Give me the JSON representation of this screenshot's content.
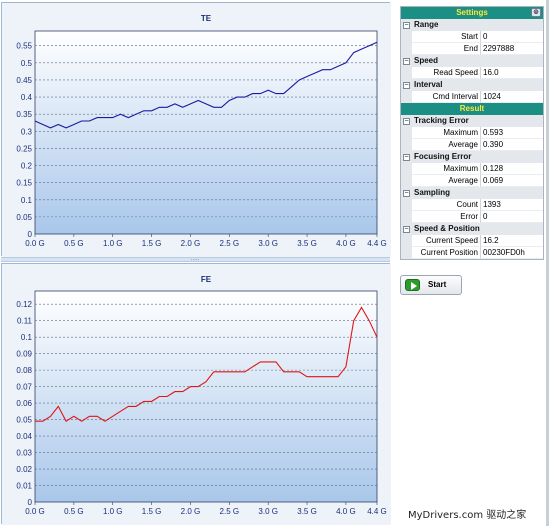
{
  "colors": {
    "te_line": "#1a1aa0",
    "fe_line": "#e01515",
    "plot_bg_top": "#ffffff",
    "plot_bg_bottom": "#a9c7ea",
    "header_bg": "#1b8f83",
    "header_text": "#ffe63a"
  },
  "chart_data": [
    {
      "type": "line",
      "title": "TE",
      "xlabel": "",
      "ylabel": "",
      "xlim": [
        0,
        4.4
      ],
      "ylim": [
        0,
        0.593
      ],
      "x_ticks": [
        "0.0 G",
        "0.5 G",
        "1.0 G",
        "1.5 G",
        "2.0 G",
        "2.5 G",
        "3.0 G",
        "3.5 G",
        "4.0 G",
        "4.4 G"
      ],
      "y_ticks": [
        "0",
        "0.05",
        "0.1",
        "0.15",
        "0.2",
        "0.25",
        "0.3",
        "0.35",
        "0.4",
        "0.45",
        "0.5",
        "0.55"
      ],
      "grid": true,
      "series": [
        {
          "color": "#1a1aa0",
          "x": [
            0,
            0.1,
            0.2,
            0.3,
            0.4,
            0.5,
            0.6,
            0.7,
            0.8,
            0.9,
            1.0,
            1.1,
            1.2,
            1.3,
            1.4,
            1.5,
            1.6,
            1.7,
            1.8,
            1.9,
            2.0,
            2.1,
            2.2,
            2.3,
            2.4,
            2.5,
            2.6,
            2.7,
            2.8,
            2.9,
            3.0,
            3.1,
            3.2,
            3.3,
            3.4,
            3.5,
            3.6,
            3.7,
            3.8,
            3.9,
            4.0,
            4.1,
            4.2,
            4.3,
            4.4
          ],
          "y": [
            0.33,
            0.32,
            0.31,
            0.32,
            0.31,
            0.32,
            0.33,
            0.33,
            0.34,
            0.34,
            0.34,
            0.35,
            0.34,
            0.35,
            0.36,
            0.36,
            0.37,
            0.37,
            0.38,
            0.37,
            0.38,
            0.39,
            0.38,
            0.37,
            0.37,
            0.39,
            0.4,
            0.4,
            0.41,
            0.41,
            0.42,
            0.41,
            0.41,
            0.43,
            0.45,
            0.46,
            0.47,
            0.48,
            0.48,
            0.49,
            0.5,
            0.53,
            0.54,
            0.55,
            0.56
          ]
        }
      ]
    },
    {
      "type": "line",
      "title": "FE",
      "xlabel": "",
      "ylabel": "",
      "xlim": [
        0,
        4.4
      ],
      "ylim": [
        0,
        0.128
      ],
      "x_ticks": [
        "0.0 G",
        "0.5 G",
        "1.0 G",
        "1.5 G",
        "2.0 G",
        "2.5 G",
        "3.0 G",
        "3.5 G",
        "4.0 G",
        "4.4 G"
      ],
      "y_ticks": [
        "0",
        "0.01",
        "0.02",
        "0.03",
        "0.04",
        "0.05",
        "0.06",
        "0.07",
        "0.08",
        "0.09",
        "0.1",
        "0.11",
        "0.12"
      ],
      "grid": true,
      "series": [
        {
          "color": "#e01515",
          "x": [
            0,
            0.1,
            0.2,
            0.3,
            0.4,
            0.5,
            0.6,
            0.7,
            0.8,
            0.9,
            1.0,
            1.1,
            1.2,
            1.3,
            1.4,
            1.5,
            1.6,
            1.7,
            1.8,
            1.9,
            2.0,
            2.1,
            2.2,
            2.3,
            2.4,
            2.5,
            2.6,
            2.7,
            2.8,
            2.9,
            3.0,
            3.1,
            3.2,
            3.3,
            3.4,
            3.5,
            3.6,
            3.7,
            3.8,
            3.9,
            4.0,
            4.1,
            4.2,
            4.3,
            4.4
          ],
          "y": [
            0.049,
            0.049,
            0.052,
            0.058,
            0.049,
            0.052,
            0.049,
            0.052,
            0.052,
            0.049,
            0.052,
            0.055,
            0.058,
            0.058,
            0.061,
            0.061,
            0.064,
            0.064,
            0.067,
            0.067,
            0.07,
            0.07,
            0.073,
            0.079,
            0.079,
            0.079,
            0.079,
            0.079,
            0.082,
            0.085,
            0.085,
            0.085,
            0.079,
            0.079,
            0.079,
            0.076,
            0.076,
            0.076,
            0.076,
            0.076,
            0.082,
            0.11,
            0.118,
            0.11,
            0.1
          ]
        }
      ]
    }
  ],
  "splitter": {
    "grip": "....."
  },
  "properties": {
    "settings_header": "Settings",
    "result_header": "Result",
    "categories": {
      "range": "Range",
      "speed": "Speed",
      "interval": "Interval",
      "tracking_error": "Tracking Error",
      "focusing_error": "Focusing Error",
      "sampling": "Sampling",
      "speed_position": "Speed & Position"
    },
    "rows": {
      "start": {
        "name": "Start",
        "value": "0"
      },
      "end": {
        "name": "End",
        "value": "2297888"
      },
      "read_speed": {
        "name": "Read Speed",
        "value": "16.0"
      },
      "cmd_interval": {
        "name": "Cmd Interval",
        "value": "1024"
      },
      "te_max": {
        "name": "Maximum",
        "value": "0.593"
      },
      "te_avg": {
        "name": "Average",
        "value": "0.390"
      },
      "fe_max": {
        "name": "Maximum",
        "value": "0.128"
      },
      "fe_avg": {
        "name": "Average",
        "value": "0.069"
      },
      "count": {
        "name": "Count",
        "value": "1393"
      },
      "error": {
        "name": "Error",
        "value": "0"
      },
      "current_speed": {
        "name": "Current Speed",
        "value": "16.2"
      },
      "current_position": {
        "name": "Current Position",
        "value": "00230FD0h"
      }
    }
  },
  "start_button": {
    "label": "Start",
    "icon": "go-icon"
  },
  "watermark": "MyDrivers.com 驱动之家"
}
